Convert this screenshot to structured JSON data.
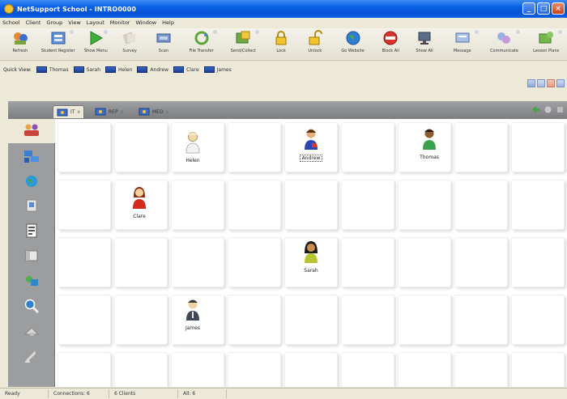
{
  "window": {
    "title": "NetSupport School - INTRO0000"
  },
  "menu": [
    "School",
    "Client",
    "Group",
    "View",
    "Layout",
    "Monitor",
    "Window",
    "Help"
  ],
  "toolbar": [
    {
      "label": "Refresh",
      "icon": "refresh-icon"
    },
    {
      "label": "Student Register",
      "icon": "student-register-icon"
    },
    {
      "label": "Show Menu",
      "icon": "show-icon"
    },
    {
      "label": "Survey",
      "icon": "survey-icon"
    },
    {
      "label": "Scan",
      "icon": "scan-icon"
    },
    {
      "label": "File Transfer",
      "icon": "file-transfer-icon"
    },
    {
      "label": "Send/Collect",
      "icon": "send-collect-icon"
    },
    {
      "label": "Lock",
      "icon": "lock-icon"
    },
    {
      "label": "Unlock",
      "icon": "unlock-icon"
    },
    {
      "label": "Go Website",
      "icon": "globe-icon"
    },
    {
      "label": "Block All",
      "icon": "block-icon"
    },
    {
      "label": "Show All",
      "icon": "monitor-icon"
    },
    {
      "label": "Message",
      "icon": "message-icon"
    },
    {
      "label": "Communicate",
      "icon": "communicate-icon"
    },
    {
      "label": "Lesson Plans",
      "icon": "lesson-plans-icon"
    }
  ],
  "quickview": {
    "label": "Quick View:",
    "items": [
      "Thomas",
      "Sarah",
      "Helen",
      "Andrew",
      "Clare",
      "James"
    ]
  },
  "tabs": [
    {
      "label": "IT",
      "active": true
    },
    {
      "label": "REP",
      "active": false
    },
    {
      "label": "MED",
      "active": false
    }
  ],
  "students": {
    "helen": "Helen",
    "andrew": "Andrew",
    "thomas": "Thomas",
    "clare": "Clare",
    "sarah": "Sarah",
    "james": "James"
  },
  "status": {
    "ready": "Ready",
    "connections": "Connections: 6",
    "clients": "6 Clients",
    "all": "All: 6"
  }
}
